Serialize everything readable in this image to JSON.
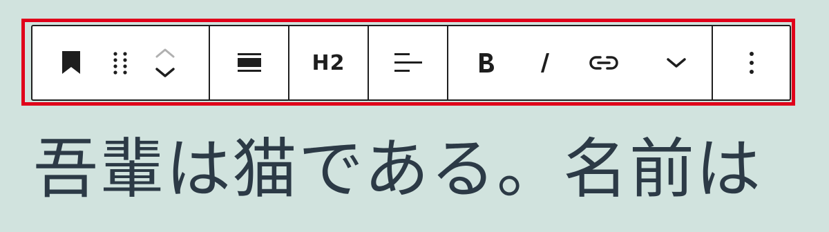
{
  "toolbar": {
    "heading_level_label": "H2",
    "buttons": [
      {
        "name": "block-type",
        "icon": "bookmark-icon"
      },
      {
        "name": "drag-handle",
        "icon": "drag-dots-icon"
      },
      {
        "name": "move-up",
        "icon": "chevron-up-icon"
      },
      {
        "name": "move-down",
        "icon": "chevron-down-icon"
      },
      {
        "name": "align",
        "icon": "align-full-icon"
      },
      {
        "name": "heading-level",
        "icon": "h2-label"
      },
      {
        "name": "text-align",
        "icon": "align-left-icon"
      },
      {
        "name": "bold",
        "icon": "bold-icon"
      },
      {
        "name": "italic",
        "icon": "italic-icon"
      },
      {
        "name": "link",
        "icon": "link-icon"
      },
      {
        "name": "more-rich-text",
        "icon": "chevron-down-icon"
      },
      {
        "name": "options",
        "icon": "kebab-menu-icon"
      }
    ],
    "highlight_color": "#e0001a"
  },
  "editor": {
    "paragraph_text": "吾輩は猫である。名前は"
  },
  "colors": {
    "background": "#d1e3de",
    "toolbar_bg": "#ffffff",
    "icon": "#1e1e1e",
    "icon_disabled": "#b0b0b0",
    "text": "#2c3a46"
  }
}
